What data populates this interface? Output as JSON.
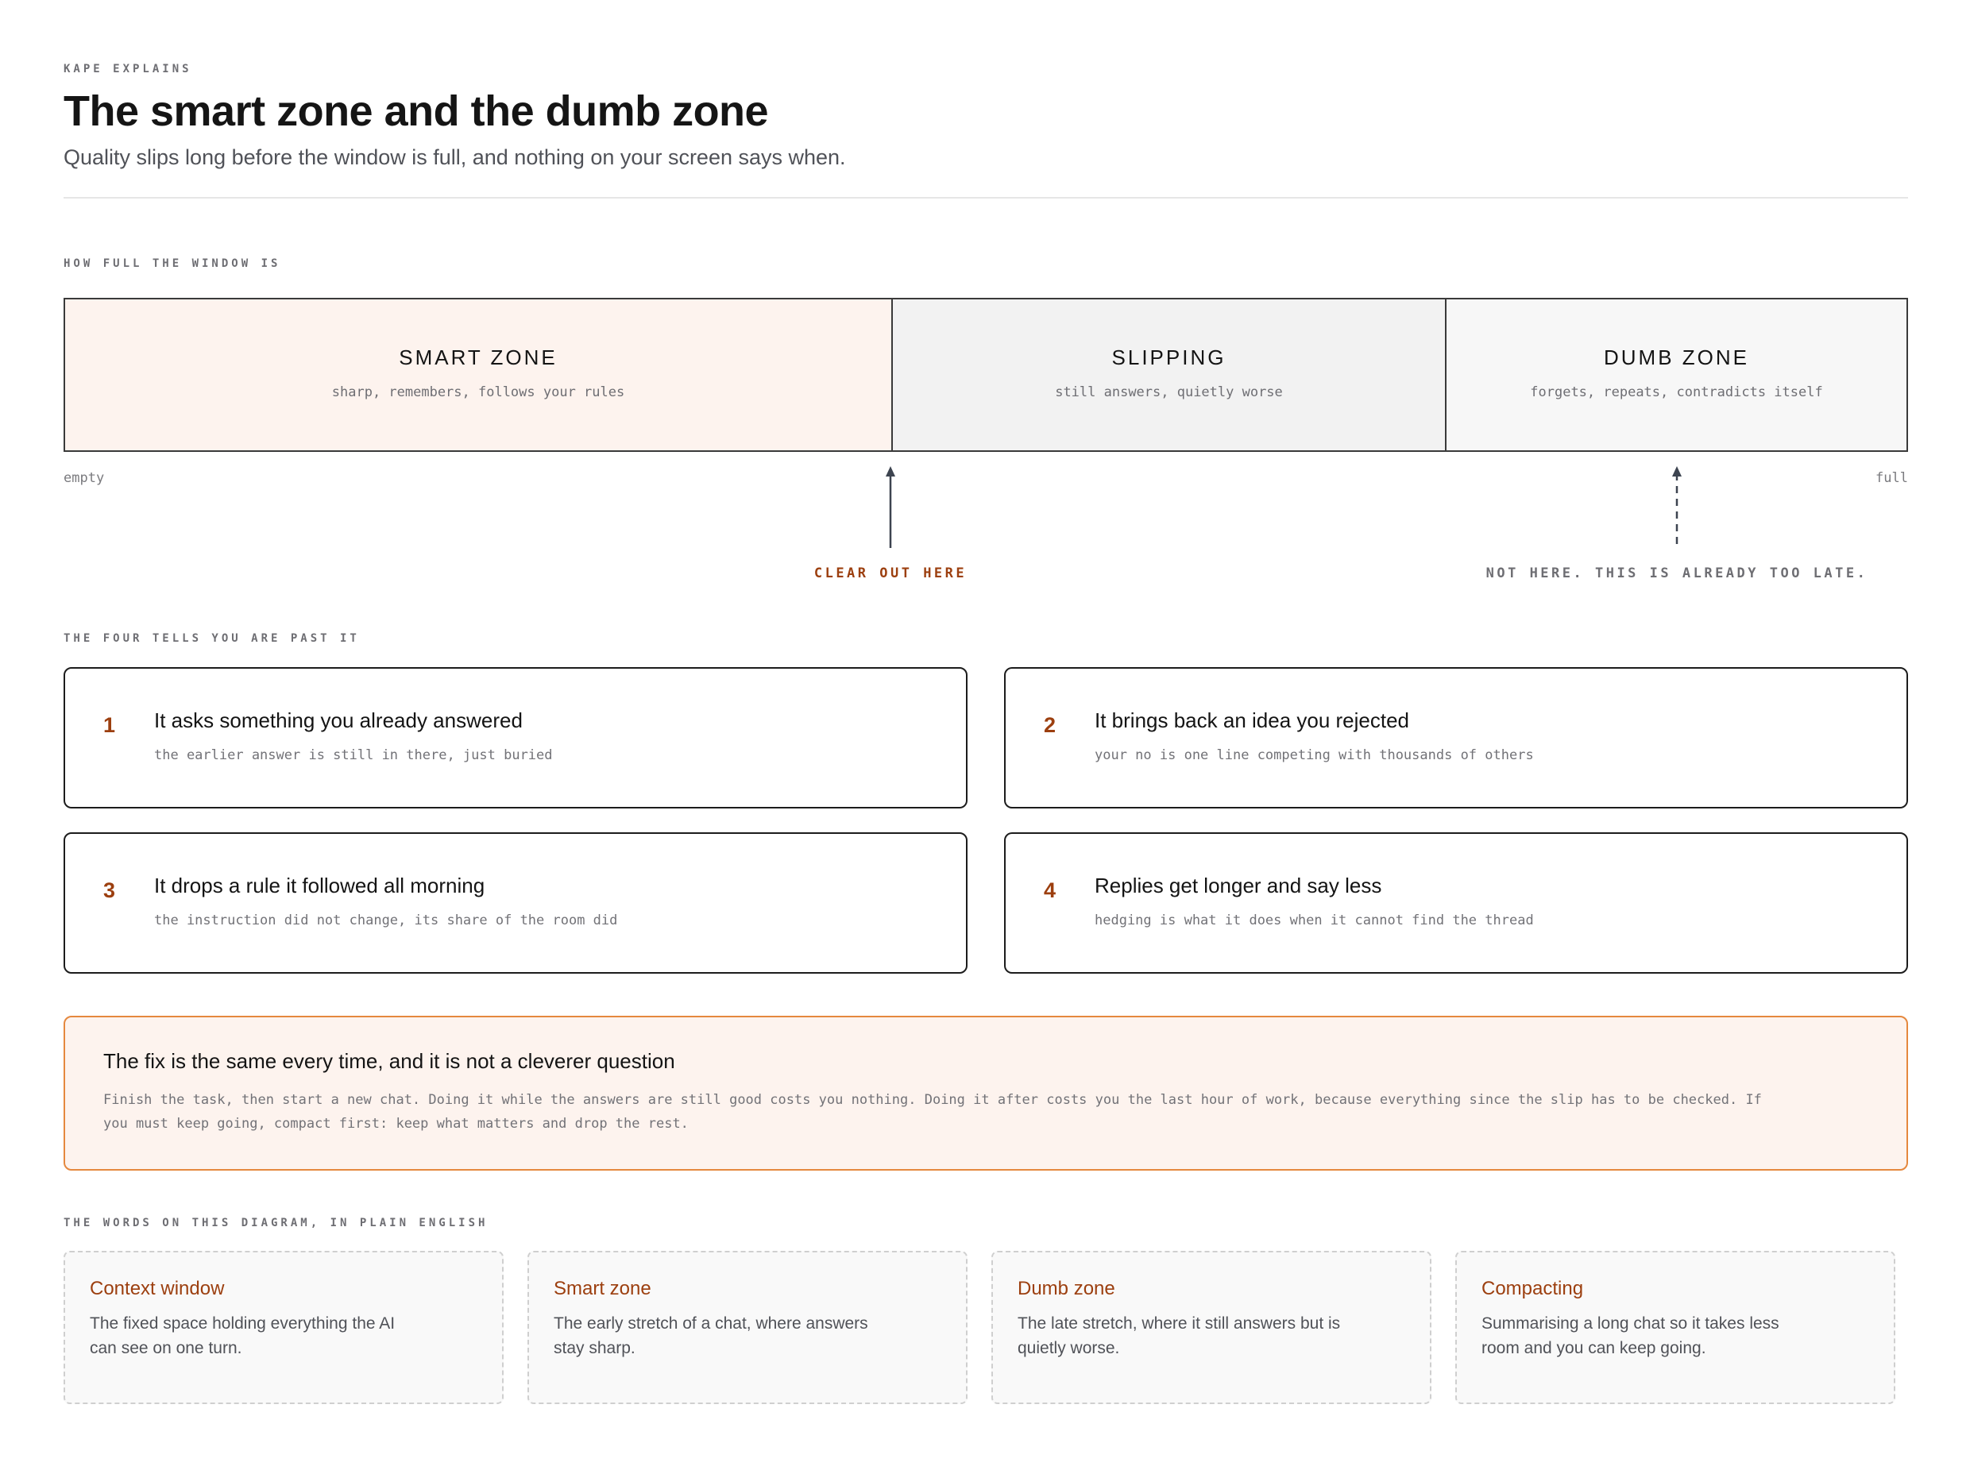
{
  "header": {
    "kicker": "KAPE EXPLAINS",
    "title": "The smart zone and the dumb zone",
    "subtitle": "Quality slips long before the window is full, and nothing on your screen says when."
  },
  "window_bar": {
    "label": "HOW FULL THE WINDOW IS",
    "zones": [
      {
        "name": "SMART ZONE",
        "description": "sharp, remembers, follows your rules",
        "color": "#fdf3ee"
      },
      {
        "name": "SLIPPING",
        "description": "still answers, quietly worse",
        "color": "#f2f2f2"
      },
      {
        "name": "DUMB ZONE",
        "description": "forgets, repeats, contradicts itself",
        "color": "#f7f7f7"
      }
    ],
    "start_label": "empty",
    "end_label": "full",
    "markers": [
      {
        "label": "CLEAR OUT HERE",
        "style": "solid-arrow",
        "color": "#9c3f0f"
      },
      {
        "label": "NOT HERE. THIS IS ALREADY TOO LATE.",
        "style": "dashed-arrow",
        "color": "#6e6e73"
      }
    ]
  },
  "tells": {
    "label": "THE FOUR TELLS YOU ARE PAST IT",
    "items": [
      {
        "number": "1",
        "title": "It asks something you already answered",
        "description": "the earlier answer is still in there, just buried"
      },
      {
        "number": "2",
        "title": "It brings back an idea you rejected",
        "description": "your no is one line competing with thousands of others"
      },
      {
        "number": "3",
        "title": "It drops a rule it followed all morning",
        "description": "the instruction did not change, its share of the room did"
      },
      {
        "number": "4",
        "title": "Replies get longer and say less",
        "description": "hedging is what it does when it cannot find the thread"
      }
    ]
  },
  "fix": {
    "title": "The fix is the same every time, and it is not a cleverer question",
    "body": "Finish the task, then start a new chat. Doing it while the answers are still good costs you nothing. Doing it after costs you the last hour of work, because everything since the slip has to be checked. If you must keep going, compact first: keep what matters and drop the rest."
  },
  "glossary": {
    "label": "THE WORDS ON THIS DIAGRAM, IN PLAIN ENGLISH",
    "items": [
      {
        "term": "Context window",
        "definition": "The fixed space holding everything the AI can see on one turn."
      },
      {
        "term": "Smart zone",
        "definition": "The early stretch of a chat, where answers stay sharp."
      },
      {
        "term": "Dumb zone",
        "definition": "The late stretch, where it still answers but is quietly worse."
      },
      {
        "term": "Compacting",
        "definition": "Summarising a long chat so it takes less room and you can keep going."
      }
    ]
  },
  "colors": {
    "accent": "#9c3f0f",
    "fix_border": "#e5883e",
    "smart_zone_fill": "#fdf3ee"
  }
}
